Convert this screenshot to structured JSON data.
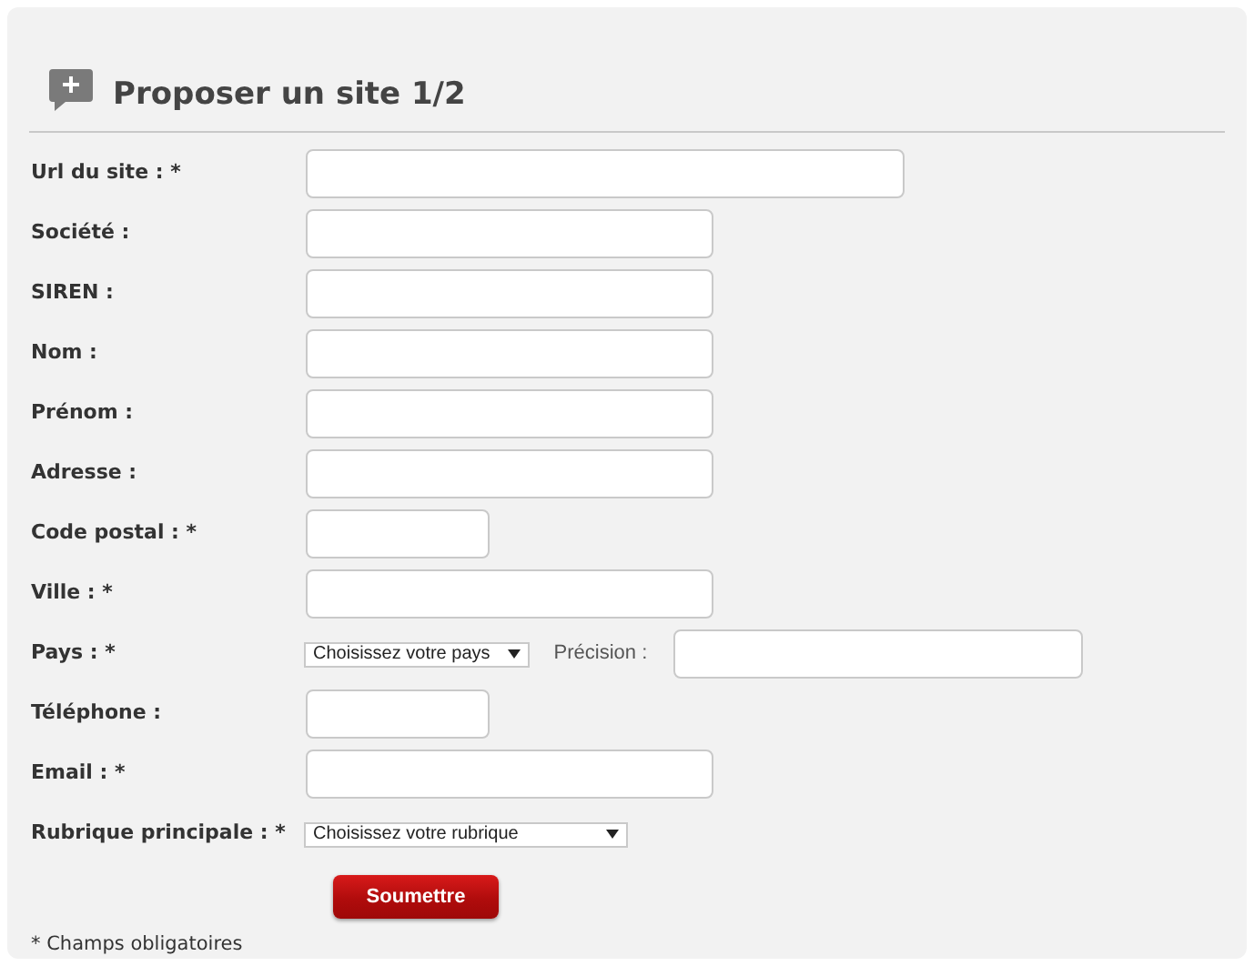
{
  "title": "Proposer un site 1/2",
  "fields": [
    {
      "label": "Url du site : *",
      "kind": "wide"
    },
    {
      "label": "Société :",
      "kind": "medium"
    },
    {
      "label": "SIREN :",
      "kind": "medium"
    },
    {
      "label": "Nom :",
      "kind": "medium"
    },
    {
      "label": "Prénom :",
      "kind": "medium"
    },
    {
      "label": "Adresse :",
      "kind": "medium"
    },
    {
      "label": "Code postal : *",
      "kind": "short"
    },
    {
      "label": "Ville : *",
      "kind": "medium"
    },
    {
      "label": "Pays : *",
      "kind": "select",
      "value": "Choisissez votre pays",
      "extra_label": "Précision :"
    },
    {
      "label": "Téléphone :",
      "kind": "short"
    },
    {
      "label": "Email : *",
      "kind": "medium"
    },
    {
      "label": "Rubrique principale : *",
      "kind": "wide-select",
      "value": "Choisissez votre rubrique"
    }
  ],
  "submit": "Soumettre",
  "footnote": "* Champs obligatoires"
}
